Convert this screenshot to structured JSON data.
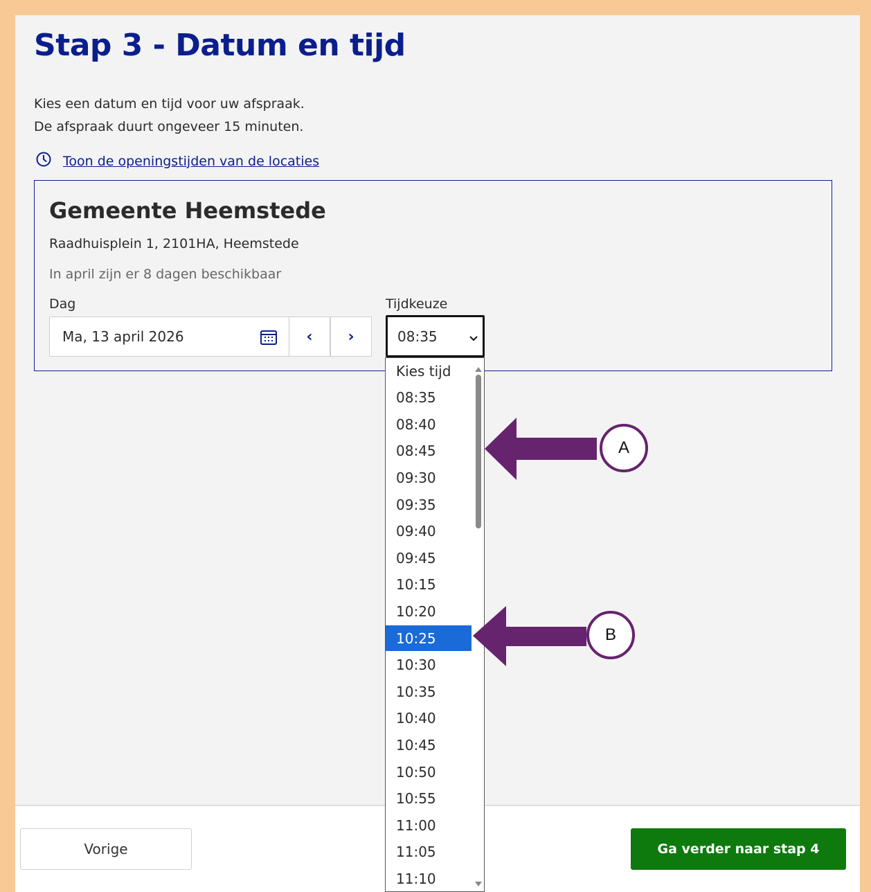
{
  "page": {
    "title": "Stap 3 - Datum en tijd",
    "intro_line1": "Kies een datum en tijd voor uw afspraak.",
    "intro_line2": "De afspraak duurt ongeveer 15 minuten.",
    "hours_link": "Toon de openingstijden van de locaties"
  },
  "location": {
    "name": "Gemeente Heemstede",
    "address": "Raadhuisplein 1, 2101HA, Heemstede",
    "availability": "In april zijn er 8 dagen beschikbaar"
  },
  "day": {
    "label": "Dag",
    "value": "Ma, 13 april 2026",
    "prev_glyph": "‹",
    "next_glyph": "›"
  },
  "time": {
    "label": "Tijdkeuze",
    "value": "08:35",
    "options": [
      "Kies tijd",
      "08:35",
      "08:40",
      "08:45",
      "09:30",
      "09:35",
      "09:40",
      "09:45",
      "10:15",
      "10:20",
      "10:25",
      "10:30",
      "10:35",
      "10:40",
      "10:45",
      "10:50",
      "10:55",
      "11:00",
      "11:05",
      "11:10"
    ],
    "highlighted": "10:25"
  },
  "footer": {
    "prev_label": "Vorige",
    "next_label": "Ga verder naar stap 4"
  },
  "annotations": {
    "a": "A",
    "b": "B"
  },
  "colors": {
    "brand_blue": "#0b1e8c",
    "continue_green": "#0e7a0e",
    "highlight_blue": "#1a6ad8",
    "arrow_purple": "#66236e",
    "frame": "#f8c994"
  }
}
